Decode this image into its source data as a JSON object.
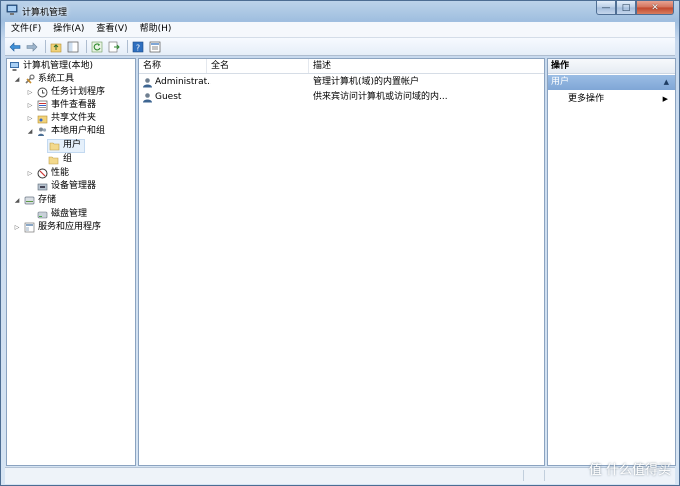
{
  "window": {
    "title": "计算机管理"
  },
  "window_buttons": {
    "minimize": "—",
    "maximize": "□",
    "close": "✕"
  },
  "menu": [
    {
      "label": "文件(F)"
    },
    {
      "label": "操作(A)"
    },
    {
      "label": "查看(V)"
    },
    {
      "label": "帮助(H)"
    }
  ],
  "toolbar": {
    "buttons": [
      "back-arrow-icon",
      "forward-arrow-icon",
      "up-folder-icon",
      "show-hide-tree-icon",
      "refresh-icon",
      "export-list-icon",
      "help-icon",
      "properties-icon"
    ]
  },
  "tree": {
    "root": "计算机管理(本地)",
    "system_tools": "系统工具",
    "task_scheduler": "任务计划程序",
    "event_viewer": "事件查看器",
    "shared_folders": "共享文件夹",
    "local_users_groups": "本地用户和组",
    "users": "用户",
    "groups": "组",
    "performance": "性能",
    "device_manager": "设备管理器",
    "storage": "存储",
    "disk_management": "磁盘管理",
    "services_apps": "服务和应用程序"
  },
  "list": {
    "columns": [
      "名称",
      "全名",
      "描述"
    ],
    "rows": [
      {
        "name": "Administrat...",
        "fullname": "",
        "desc": "管理计算机(域)的内置帐户"
      },
      {
        "name": "Guest",
        "fullname": "",
        "desc": "供来宾访问计算机或访问域的内..."
      }
    ]
  },
  "actions": {
    "header": "操作",
    "section": "用户",
    "more": "更多操作"
  },
  "watermark": "值 什么值得买",
  "colors": {
    "accent": "#7fa6d6",
    "window_frame": "#9fbedf"
  }
}
